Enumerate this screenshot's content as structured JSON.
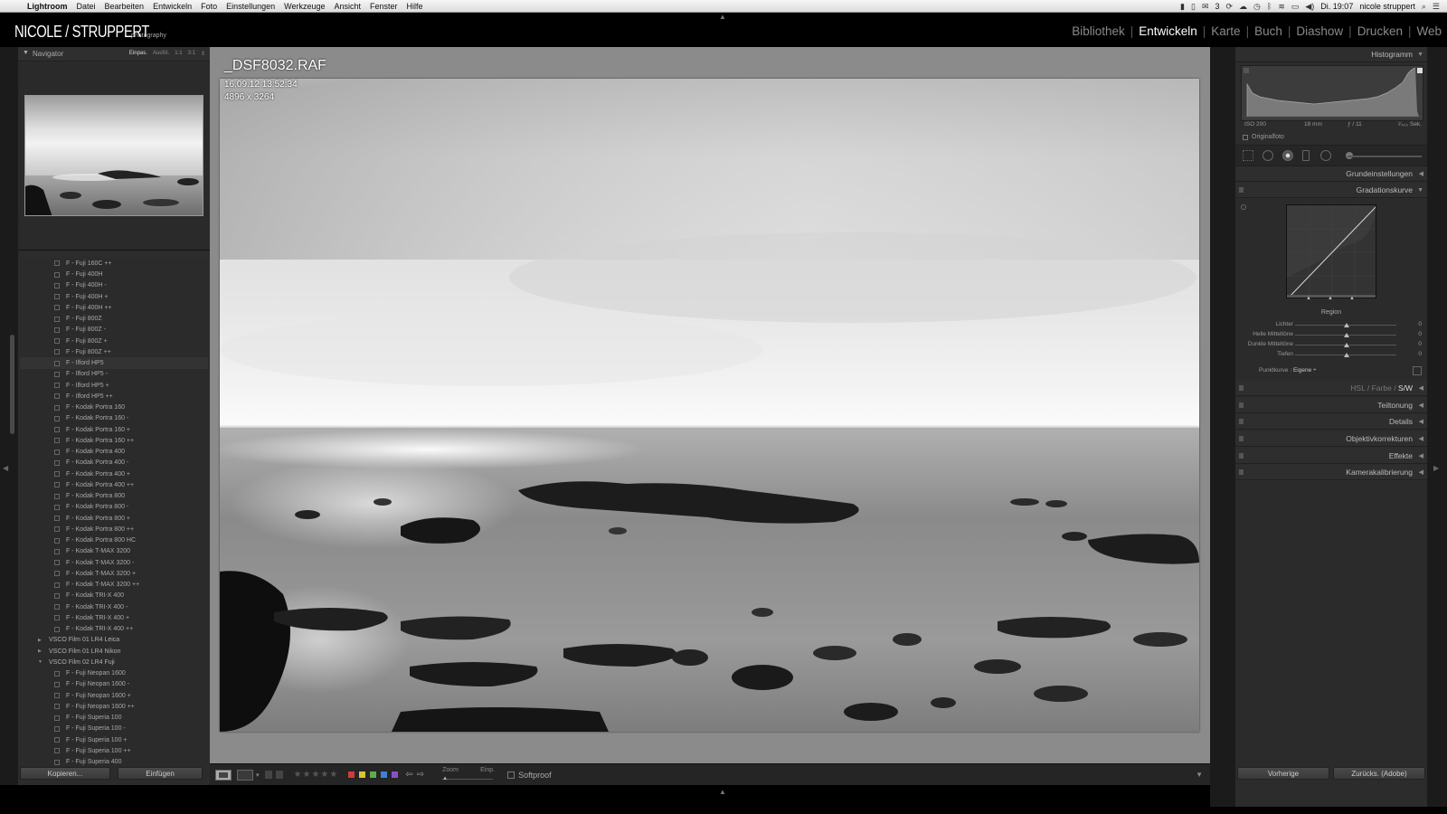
{
  "menubar": {
    "app": "Lightroom",
    "items": [
      "Datei",
      "Bearbeiten",
      "Entwickeln",
      "Foto",
      "Einstellungen",
      "Werkzeuge",
      "Ansicht",
      "Fenster",
      "Hilfe"
    ],
    "badge": "3",
    "time": "Di. 19:07",
    "user": "nicole struppert"
  },
  "identity": {
    "name": "NICOLE / STRUPPERT",
    "sub": "photography"
  },
  "modules": [
    "Bibliothek",
    "Entwickeln",
    "Karte",
    "Buch",
    "Diashow",
    "Drucken",
    "Web"
  ],
  "active_module": "Entwickeln",
  "navigator": {
    "title": "Navigator",
    "zooms": [
      "Einpas.",
      "Ausfül.",
      "1:1",
      "3:1"
    ],
    "active_zoom": "Einpas."
  },
  "presets": {
    "group1": [
      "F - Fuji 160C ++",
      "F - Fuji 400H",
      "F - Fuji 400H -",
      "F - Fuji 400H +",
      "F - Fuji 400H ++",
      "F - Fuji 800Z",
      "F - Fuji 800Z -",
      "F - Fuji 800Z +",
      "F - Fuji 800Z ++",
      "F - Ilford HP5",
      "F - Ilford HP5 -",
      "F - Ilford HP5 +",
      "F - Ilford HP5 ++",
      "F - Kodak Portra 160",
      "F - Kodak Portra 160 -",
      "F - Kodak Portra 160 +",
      "F - Kodak Portra 160 ++",
      "F - Kodak Portra 400",
      "F - Kodak Portra 400 -",
      "F - Kodak Portra 400 +",
      "F - Kodak Portra 400 ++",
      "F - Kodak Portra 800",
      "F - Kodak Portra 800 -",
      "F - Kodak Portra 800 +",
      "F - Kodak Portra 800 ++",
      "F - Kodak Portra 800 HC",
      "F - Kodak T-MAX 3200",
      "F - Kodak T-MAX 3200 -",
      "F - Kodak T-MAX 3200 +",
      "F - Kodak T-MAX 3200 ++",
      "F - Kodak TRI-X 400",
      "F - Kodak TRI-X 400 -",
      "F - Kodak TRI-X 400 +",
      "F - Kodak TRI-X 400 ++"
    ],
    "folders": [
      "VSCO Film 01 LR4 Leica",
      "VSCO Film 01 LR4 Nikon",
      "VSCO Film 02 LR4 Fuji"
    ],
    "group2": [
      "F - Fuji Neopan 1600",
      "F - Fuji Neopan 1600 -",
      "F - Fuji Neopan 1600 +",
      "F - Fuji Neopan 1600 ++",
      "F - Fuji Superia 100",
      "F - Fuji Superia 100 -",
      "F - Fuji Superia 100 +",
      "F - Fuji Superia 100 ++",
      "F - Fuji Superia 400"
    ],
    "highlighted": "F - Ilford HP5"
  },
  "left_buttons": {
    "copy": "Kopieren...",
    "paste": "Einfügen"
  },
  "photo": {
    "filename": "_DSF8032.RAF",
    "date": "16.09.12 13:52:34",
    "dimensions": "4896 x 3264"
  },
  "toolbar": {
    "zoom_label": "Zoom",
    "zoom_value": "Einp.",
    "softproof": "Softproof",
    "label_colors": [
      "#d23b3b",
      "#d6c438",
      "#5cb04a",
      "#3f7fd6",
      "#8a4fc8"
    ]
  },
  "histogram": {
    "title": "Histogramm",
    "iso": "ISO 200",
    "focal": "18 mm",
    "aperture": "ƒ / 11",
    "shutter": "¹⁄₄₀₀ Sek.",
    "original": "Originalfoto"
  },
  "panels": {
    "basic": "Grundeinstellungen",
    "curve": "Gradationskurve",
    "hsl": [
      "HSL",
      "Farbe",
      "S/W"
    ],
    "hsl_active": "S/W",
    "split": "Teiltonung",
    "details": "Details",
    "lens": "Objektivkorrekturen",
    "effects": "Effekte",
    "calibration": "Kamerakalibrierung"
  },
  "curve": {
    "region": "Region",
    "rows": [
      {
        "label": "Lichter",
        "value": "0"
      },
      {
        "label": "Helle Mitteltöne",
        "value": "0"
      },
      {
        "label": "Dunkle Mitteltöne",
        "value": "0"
      },
      {
        "label": "Tiefen",
        "value": "0"
      }
    ],
    "punktkurve_label": "Punktkurve :",
    "punktkurve_value": "Eigene ÷"
  },
  "right_buttons": {
    "previous": "Vorherige",
    "reset": "Zurücks. (Adobe)"
  }
}
